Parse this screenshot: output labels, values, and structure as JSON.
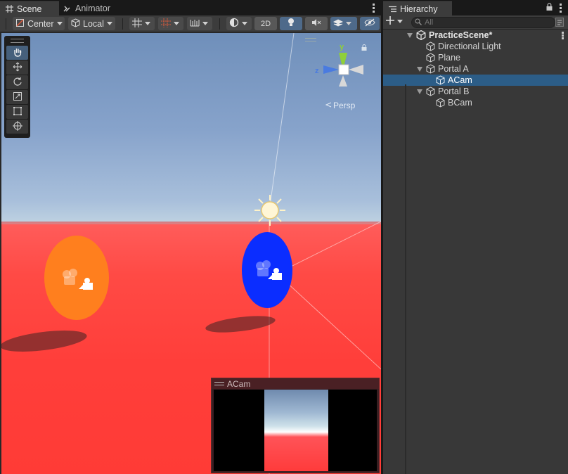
{
  "scene_panel": {
    "tabs": [
      {
        "label": "Scene",
        "icon": "grid-icon",
        "active": true
      },
      {
        "label": "Animator",
        "icon": "animator-icon",
        "active": false
      }
    ],
    "toolbar": {
      "pivot_label": "Center",
      "space_label": "Local",
      "mode_2d_label": "2D"
    },
    "tools": [
      "hand-tool",
      "move-tool",
      "rotate-tool",
      "scale-tool",
      "rect-tool",
      "transform-tool"
    ],
    "gizmo": {
      "y_label": "y",
      "z_label": "z",
      "projection_label": "Persp"
    },
    "camera_preview": {
      "title": "ACam"
    },
    "colors": {
      "ground": "#ff4a45",
      "portal_a": "#ff7f1e",
      "portal_b": "#0b2dff",
      "sky": "#87a3cb"
    }
  },
  "hierarchy": {
    "tab_label": "Hierarchy",
    "search_placeholder": "All",
    "items": [
      {
        "label": "PracticeScene*",
        "depth": 0,
        "type": "scene",
        "expanded": true
      },
      {
        "label": "Directional Light",
        "depth": 1,
        "type": "gameobject"
      },
      {
        "label": "Plane",
        "depth": 1,
        "type": "gameobject"
      },
      {
        "label": "Portal A",
        "depth": 1,
        "type": "gameobject",
        "expanded": true
      },
      {
        "label": "ACam",
        "depth": 2,
        "type": "gameobject",
        "selected": true
      },
      {
        "label": "Portal B",
        "depth": 1,
        "type": "gameobject",
        "expanded": true
      },
      {
        "label": "BCam",
        "depth": 2,
        "type": "gameobject"
      }
    ],
    "colors": {
      "selection": "#2c5d87"
    }
  }
}
